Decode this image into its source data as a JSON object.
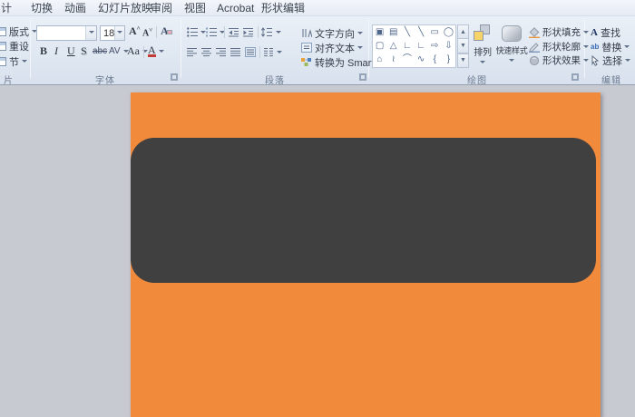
{
  "tabs": [
    {
      "label": "计"
    },
    {
      "label": "切换"
    },
    {
      "label": "动画"
    },
    {
      "label": "幻灯片放映"
    },
    {
      "label": "审阅"
    },
    {
      "label": "视图"
    },
    {
      "label": "Acrobat"
    },
    {
      "label": "形状编辑"
    }
  ],
  "slides_group": {
    "layout": "版式",
    "reset": "重设",
    "section": "节",
    "label": "片"
  },
  "font_group": {
    "font_name": "",
    "font_size": "18",
    "bold": "B",
    "italic": "I",
    "underline": "U",
    "shadow": "S",
    "strikethrough": "abc",
    "char_spacing": "AV",
    "change_case": "Aa",
    "font_color": "A",
    "label": "字体"
  },
  "paragraph_group": {
    "text_direction": "文字方向",
    "align_text": "对齐文本",
    "smartart": "转换为 SmartArt",
    "label": "段落"
  },
  "drawing_group": {
    "shapes": [
      "▣",
      "▤",
      "╲",
      "╲",
      "▭",
      "◯",
      "▢",
      "△",
      "∟",
      "∟",
      "⇨",
      "⇩",
      "⌂",
      "≀",
      "⌒",
      "∿",
      "{",
      "}"
    ],
    "gallery_scroll": {
      "up": "▲",
      "down": "▼",
      "more": "▼"
    },
    "arrange": "排列",
    "quick_styles": "快速样式",
    "shape_fill": "形状填充",
    "shape_outline": "形状轮廓",
    "shape_effects": "形状效果",
    "label": "绘图"
  },
  "editing_group": {
    "find": "查找",
    "replace": "替换",
    "select": "选择",
    "label": "编辑"
  },
  "canvas": {
    "slide_color": "#F28A3C",
    "shape_color": "#404040",
    "workspace_color": "#C7CAD0"
  }
}
